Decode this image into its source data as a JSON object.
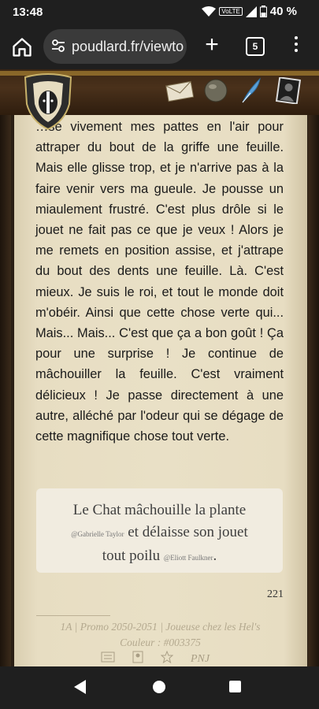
{
  "status_bar": {
    "time": "13:48",
    "network_label": "VoLTE",
    "battery": "40 %"
  },
  "browser": {
    "url": "poudlard.fr/viewto",
    "tab_count": "5"
  },
  "post": {
    "paragraph": "…se vivement mes pattes en l'air pour attraper du bout de la griffe une feuille. Mais elle glisse trop, et je n'arrive pas à la faire venir vers ma gueule. Je pousse un miaulement frustré. C'est plus drôle si le jouet ne fait pas ce que je veux ! Alors je me remets en position assise, et j'attrape du bout des dents une feuille. Là. C'est mieux. Je suis le roi, et tout le monde doit m'obéir. Ainsi que cette chose verte qui... Mais... Mais... C'est que ça a bon goût ! Ça pour une surprise ! Je continue de mâchouiller la feuille. C'est vraiment délicieux ! Je passe directement à une autre, alléché par l'odeur qui se dégage de cette magnifique chose tout verte.",
    "quote_part1": "Le Chat mâchouille la plante",
    "quote_tag1": "@Gabrielle Taylor",
    "quote_part2": "et délaisse son jouet",
    "quote_part3": "tout poilu",
    "quote_tag2": "@Eliott Faulkner",
    "quote_end": ".",
    "word_count": "221",
    "signature_line1": "1A | Promo 2050-2051 | Joueuse chez les Hel's",
    "signature_line2": "Couleur : #003375",
    "pnj_label": "PNJ"
  },
  "colors": {
    "parchment": "#e9e0c6",
    "header_brown": "#4a311b",
    "system_bar": "#1f1f1f"
  }
}
